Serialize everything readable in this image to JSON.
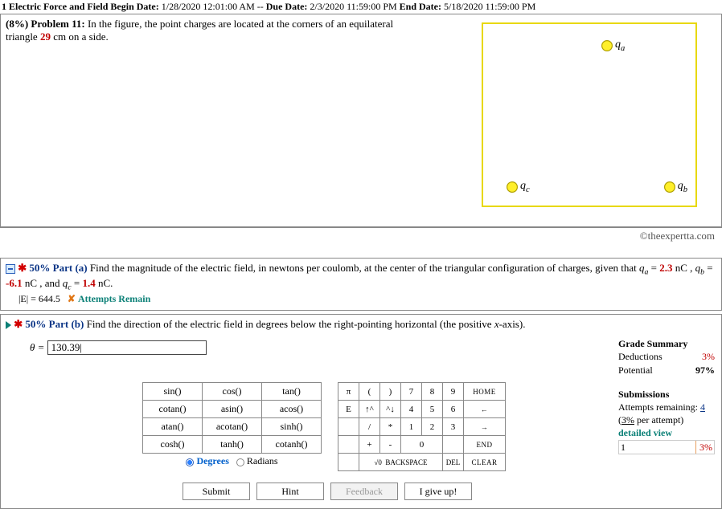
{
  "assignment": {
    "prefix": "1 Electric Force and Field",
    "begin_label": "Begin Date:",
    "begin": "1/28/2020 12:01:00 AM",
    "sep": "--",
    "due_label": "Due Date:",
    "due": "2/3/2020 11:59:00 PM",
    "end_label": "End Date:",
    "end": "5/18/2020 11:59:00 PM"
  },
  "problem": {
    "weight_label": "(8%)  Problem 11:",
    "text1": "In the figure, the point charges are located at the corners of an equilateral triangle ",
    "side_value": "29",
    "text2": " cm on a side.",
    "copyright": "©theexpertta.com",
    "charges": {
      "qa": "q",
      "qa_sub": "a",
      "qb": "q",
      "qb_sub": "b",
      "qc": "q",
      "qc_sub": "c"
    }
  },
  "partA": {
    "percent": "50% Part (a)",
    "text1": "Find the magnitude of the electric field, in newtons per coulomb, at the center of the triangular configuration of charges, given that ",
    "qa_label": "q",
    "qa_sub": "a",
    "eq1": " = ",
    "qa_val": "2.3",
    "u1": " nC , ",
    "qb_label": "q",
    "qb_sub": "b",
    "eq2": " = ",
    "qb_val": "-6.1",
    "u2": " nC , and ",
    "qc_label": "q",
    "qc_sub": "c",
    "eq3": " = ",
    "qc_val": "1.4",
    "u3": " nC.",
    "answer_label": "|E| = 644.5",
    "attempts_x": "✘",
    "attempts": "Attempts Remain"
  },
  "partB": {
    "percent": "50% Part (b)",
    "text": "Find the direction of the electric field in degrees below the right-pointing horizontal (the positive ",
    "xaxis": "x",
    "text2": "-axis).",
    "theta": "θ =",
    "input_value": "130.39|"
  },
  "funcs": [
    [
      "sin()",
      "cos()",
      "tan()"
    ],
    [
      "cotan()",
      "asin()",
      "acos()"
    ],
    [
      "atan()",
      "acotan()",
      "sinh()"
    ],
    [
      "cosh()",
      "tanh()",
      "cotanh()"
    ]
  ],
  "degrees": "Degrees",
  "radians": "Radians",
  "calc": {
    "r1": [
      "π",
      "(",
      ")",
      "7",
      "8",
      "9",
      "HOME"
    ],
    "r2": [
      "E",
      "↑^",
      "^↓",
      "4",
      "5",
      "6",
      "←"
    ],
    "r3": [
      "",
      "/",
      "*",
      "1",
      "2",
      "3",
      "→"
    ],
    "r4": [
      "",
      "+",
      "-",
      "0",
      "",
      "",
      "END"
    ],
    "r5": [
      "",
      "√0  BACKSPACE",
      "DEL",
      "CLEAR"
    ]
  },
  "buttons": {
    "submit": "Submit",
    "hint": "Hint",
    "feedback": "Feedback",
    "giveup": "I give up!"
  },
  "sidebar": {
    "grade_title": "Grade Summary",
    "ded_label": "Deductions",
    "ded_val": "3%",
    "pot_label": "Potential",
    "pot_val": "97%",
    "sub_title": "Submissions",
    "att_label": "Attempts remaining:",
    "att_val": "4",
    "per_label": "(",
    "per_val": "3%",
    "per_label2": " per attempt)",
    "detailed": "detailed view",
    "r1_a": "1",
    "r1_b": "3%"
  }
}
